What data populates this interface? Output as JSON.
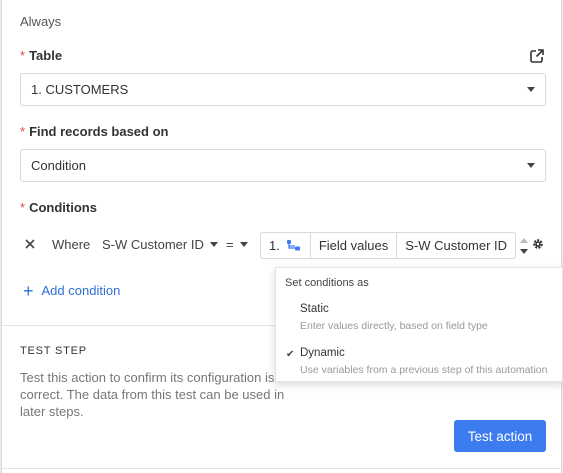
{
  "header": {
    "trigger_label": "Always"
  },
  "table_field": {
    "label": "Table",
    "value": "1. CUSTOMERS"
  },
  "find_field": {
    "label": "Find records based on",
    "value": "Condition"
  },
  "conditions": {
    "label": "Conditions",
    "rows": [
      {
        "where": "Where",
        "field": "S-W Customer ID",
        "operator": "=",
        "value_step": "1.",
        "value_mode": "Field values",
        "value_field": "S-W Customer ID"
      }
    ],
    "add_label": "Add condition"
  },
  "test_step": {
    "title": "TEST STEP",
    "description": "Test this action to confirm its configuration is correct. The data from this test can be used in later steps.",
    "button_label": "Test action"
  },
  "set_conditions_menu": {
    "heading": "Set conditions as",
    "options": [
      {
        "title": "Static",
        "subtitle": "Enter values directly, based on field type",
        "selected": false
      },
      {
        "title": "Dynamic",
        "subtitle": "Use variables from a previous step of this automation",
        "selected": true
      }
    ]
  },
  "colors": {
    "accent": "#3d7cf0",
    "link": "#2f6fd6",
    "required": "#e5484d"
  },
  "icons": [
    "open-external-icon",
    "remove-condition-icon",
    "step-branch-icon",
    "spinner-icon",
    "gear-icon",
    "check-icon",
    "plus-icon"
  ]
}
